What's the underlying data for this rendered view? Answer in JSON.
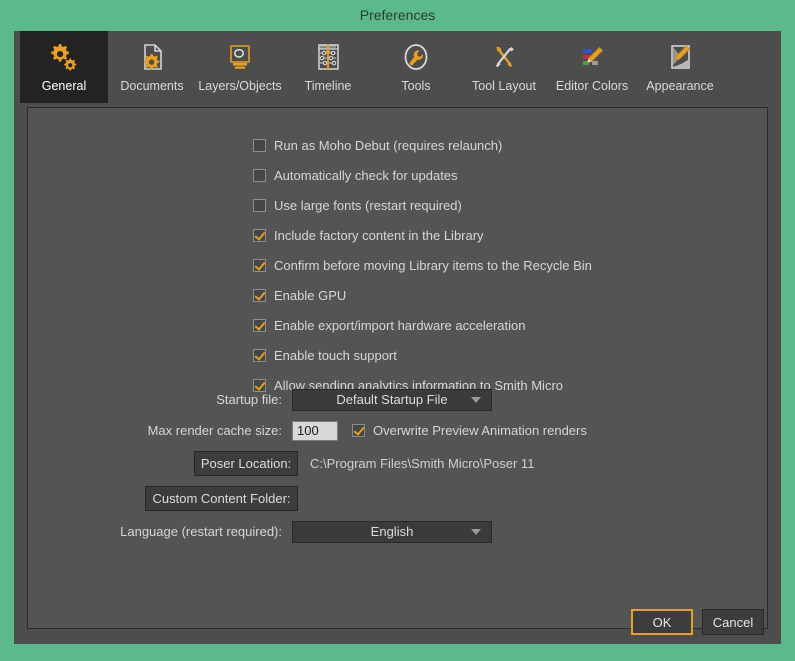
{
  "window": {
    "title": "Preferences",
    "accent_green": "#5bb98c",
    "accent_orange": "#e8a01e"
  },
  "tabs": [
    {
      "label": "General",
      "icon": "gears-icon",
      "active": true
    },
    {
      "label": "Documents",
      "icon": "document-gear-icon",
      "active": false
    },
    {
      "label": "Layers/Objects",
      "icon": "layers-icon",
      "active": false
    },
    {
      "label": "Timeline",
      "icon": "timeline-icon",
      "active": false
    },
    {
      "label": "Tools",
      "icon": "wrench-circle-icon",
      "active": false
    },
    {
      "label": "Tool Layout",
      "icon": "wrench-screwdriver-icon",
      "active": false
    },
    {
      "label": "Editor Colors",
      "icon": "color-swatches-icon",
      "active": false
    },
    {
      "label": "Appearance",
      "icon": "appearance-icon",
      "active": false
    }
  ],
  "general": {
    "checkboxes": [
      {
        "label": "Run as Moho Debut (requires relaunch)",
        "checked": false
      },
      {
        "label": "Automatically check for updates",
        "checked": false
      },
      {
        "label": "Use large fonts (restart required)",
        "checked": false
      },
      {
        "label": "Include factory content in the Library",
        "checked": true
      },
      {
        "label": "Confirm before moving Library items to the Recycle Bin",
        "checked": true
      },
      {
        "label": "Enable GPU",
        "checked": true
      },
      {
        "label": "Enable export/import hardware acceleration",
        "checked": true
      },
      {
        "label": "Enable touch support",
        "checked": true
      },
      {
        "label": "Allow sending analytics information to Smith Micro",
        "checked": true
      }
    ],
    "startup_file": {
      "label": "Startup file:",
      "value": "Default Startup File"
    },
    "max_render_cache": {
      "label": "Max render cache size:",
      "value": "100"
    },
    "overwrite_preview": {
      "label": "Overwrite Preview Animation renders",
      "checked": true
    },
    "poser_location": {
      "button_label": "Poser Location:",
      "path": "C:\\Program Files\\Smith Micro\\Poser 11"
    },
    "custom_content_folder": {
      "button_label": "Custom Content Folder:",
      "path": ""
    },
    "language": {
      "label": "Language (restart required):",
      "value": "English"
    }
  },
  "footer": {
    "ok_label": "OK",
    "cancel_label": "Cancel"
  }
}
